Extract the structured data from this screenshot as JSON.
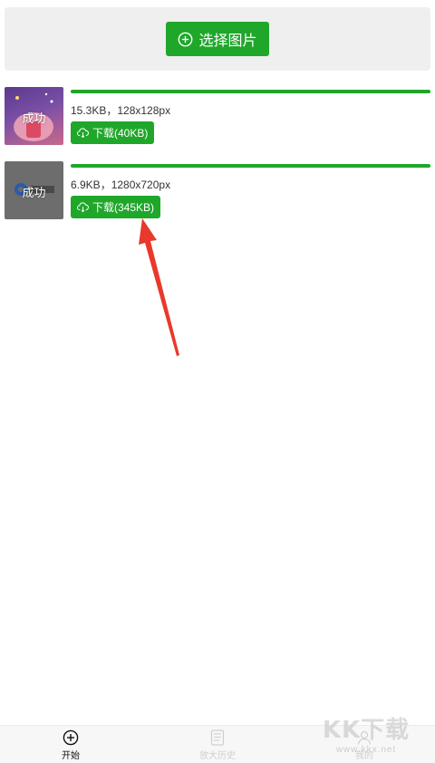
{
  "top": {
    "select_button_label": "选择图片",
    "plus_icon": "plus-circle-icon"
  },
  "items": [
    {
      "thumb_label": "成功",
      "progress": 1.0,
      "info": "15.3KB，128x128px",
      "download_label": "下载(40KB)",
      "download_icon": "cloud-download-icon"
    },
    {
      "thumb_label": "成功",
      "progress": 1.0,
      "info": "6.9KB，1280x720px",
      "download_label": "下载(345KB)",
      "download_icon": "cloud-download-icon"
    }
  ],
  "tabbar": {
    "tabs": [
      {
        "label": "开始",
        "icon": "plus-circle-icon",
        "active": true
      },
      {
        "label": "放大历史",
        "icon": "document-icon",
        "active": false
      },
      {
        "label": "我的",
        "icon": "user-icon",
        "active": false
      }
    ]
  },
  "watermark": {
    "logo": "KK下载",
    "url": "www.kkx.net"
  },
  "colors": {
    "accent": "#1fa72a",
    "arrow": "#e8392b"
  }
}
